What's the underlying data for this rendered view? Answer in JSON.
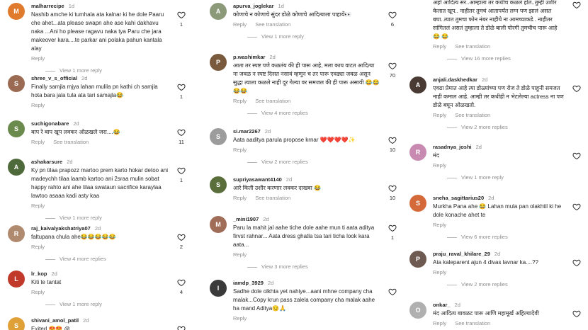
{
  "ui": {
    "reply": "Reply",
    "see_translation": "See translation"
  },
  "col1": [
    {
      "user": "malharrecipe",
      "age": "1d",
      "text": "Nashib amche ki tumhala ata kalnar ki he dole Paaru che ahet...ata please swapn ahe ase kahi dakhavu naka ...Ani ho please ragavu naka tya Paru che jara makeover kara....te parkar ani polaka pahun kantala alay",
      "likes": "1",
      "translate": false,
      "replies": "View 1 more reply",
      "avatar_color": "#e07b2e",
      "avatar_letter": "M"
    },
    {
      "user": "shree_v_s_official",
      "age": "2d",
      "text": "Finally samjla mjya lahan mulila pn kathi ch samjla hota bara jala tula ata tari samajla😂",
      "likes": "1",
      "translate": false,
      "replies": "",
      "avatar_color": "#9a6a53",
      "avatar_letter": "S"
    },
    {
      "user": "suchigonabare",
      "age": "2d",
      "text": "बाप रे बाप खूप लवकर ओळखले जरा....😂",
      "likes": "11",
      "translate": true,
      "replies": "",
      "avatar_color": "#6b8a4e",
      "avatar_letter": "S"
    },
    {
      "user": "ashakarsure",
      "age": "2d",
      "text": "Ky pn tilaa prapozz martoo prem karto hokar detoo ani madeychh tilaa laamb kartoo ani 2sraa mulin sobat happy rahto ani ahe tilaa swataun sacrifice karaylaa lawtoo asaaa kadi asty kaa",
      "likes": "1",
      "translate": false,
      "replies": "View 1 more reply",
      "avatar_color": "#4f6a3a",
      "avatar_letter": "A"
    },
    {
      "user": "raj_kaivalyakshatriya07",
      "age": "2d",
      "text": "faltupana chula ahe😂😂😂😂😂",
      "likes": "2",
      "translate": false,
      "replies": "View 4 more replies",
      "avatar_color": "#b08a6e",
      "avatar_letter": "R"
    },
    {
      "user": "lr_kop",
      "age": "2d",
      "text": "Kiti te tantat",
      "likes": "4",
      "translate": false,
      "replies": "View 1 more reply",
      "avatar_color": "#c0392b",
      "avatar_letter": "L"
    },
    {
      "user": "shivani_amol_patil",
      "age": "2d",
      "text": "Exited 😍😍 @ ...",
      "likes": "",
      "translate": false,
      "replies": "",
      "avatar_color": "#e0a038",
      "avatar_letter": "S"
    }
  ],
  "col2": [
    {
      "user": "apurva_joglekar",
      "age": "1d",
      "text": "कोणाचे न कोणाचे सुंदर डोळे कोणाचे आदित्याला पाहायें👀",
      "likes": "6",
      "translate": true,
      "replies": "View 1 more reply",
      "avatar_color": "#8c9a7a",
      "avatar_letter": "A"
    },
    {
      "user": "p.washimkar",
      "age": "2d",
      "text": "आता तर स्पष्ट पणे कळतंय की ही पारू आहे, मला काय वाटत आदित्या ना जवळ न स्पष्ट दिसत नसावं म्हणून च तर पारू एवढ्या जवळ असून सुद्धा त्याला कळले नाही दूर गेल्या वर समजल की ही पारू असावी 😂😂😂😂",
      "likes": "70",
      "translate": true,
      "replies": "View 4 more replies",
      "avatar_color": "#7a5a3c",
      "avatar_letter": "P"
    },
    {
      "user": "si.mar2267",
      "age": "2d",
      "text": "Aata aaditya parula propose krnar ❤️❤️❤️❤️✨",
      "likes": "10",
      "translate": false,
      "replies": "View 2 more replies",
      "avatar_color": "#9c9c9c",
      "avatar_letter": "S"
    },
    {
      "user": "supriyasawant4140",
      "age": "2d",
      "text": "आरे किती उशीर करणार लवकर दाखवा 😂",
      "likes": "10",
      "translate": true,
      "replies": "",
      "avatar_color": "#5a6e3c",
      "avatar_letter": "S"
    },
    {
      "user": "_mini1907",
      "age": "2d",
      "text": "Paru la mahit jal aahe tiche dole aahe mun ti aata aditya firvst rahnar... Aata dress ghatla tsa tari ticha look kara aata...",
      "likes": "1",
      "translate": false,
      "replies": "View 3 more replies",
      "avatar_color": "#a06e58",
      "avatar_letter": "M"
    },
    {
      "user": "iamdp_3929",
      "age": "2d",
      "text": "Sadhe dole olkhta yet nahiye...aani mhne company cha malak...Copy krun pass zalela company cha malak aahe ha mand Aditya😏🙏",
      "likes": "",
      "translate": false,
      "replies": "",
      "avatar_color": "#3a3a3a",
      "avatar_letter": "I"
    }
  ],
  "col3": [
    {
      "user": "",
      "age": "",
      "text": "अहो आदित्य सर..आम्हाला तर कधीच कळलं होतं..तुम्ही उशीर केलात खूप.. नाहीतर तुमचं आतापर्यंत लग्न पण झालं असत बघा..त्यात तुमचा फोन नंबर नाहीये ना आमच्याकडे.. नाहीतर सांगितलं असतं तुम्हाला ते डोळे बाली पोरगी तुमचीच पारू आहे 😂 😂",
      "likes": "",
      "translate": true,
      "replies": "View 16 more replies",
      "avatar_color": "",
      "avatar_letter": ""
    },
    {
      "user": "anjali.daskhedkar",
      "age": "2d",
      "text": "एवढा प्रेमात आहे त्या डोळ्यांच्या पण रोज ते डोळे पाहुनी समजत नाही कमाल आहे. आम्ही तर कधीही न भेटलेल्या actress ना पण डोळे बघून ओळखतो.",
      "likes": "",
      "translate": true,
      "replies": "View 2 more replies",
      "avatar_color": "#4a3a34",
      "avatar_letter": "A"
    },
    {
      "user": "rasadnya_joshi",
      "age": "2d",
      "text": "मंद",
      "likes": "",
      "translate": false,
      "replies": "View 1 more reply",
      "avatar_color": "#c88ab0",
      "avatar_letter": "R"
    },
    {
      "user": "sneha_sagittarius20",
      "age": "2d",
      "text": "Murkha Pana ahe 😂 Lahan mula pan olakhtil ki he dole konache ahet te",
      "likes": "",
      "translate": false,
      "replies": "View 6 more replies",
      "avatar_color": "#d46a3a",
      "avatar_letter": "S"
    },
    {
      "user": "praju_raval_khilare_29",
      "age": "2d",
      "text": "Ata kaleparent ajun 4 divas lavnar ka....??",
      "likes": "",
      "translate": false,
      "replies": "View 2 more replies",
      "avatar_color": "#6e5a50",
      "avatar_letter": "P"
    },
    {
      "user": "onkar_",
      "age": "2d",
      "text": "मंद आदित्य बावळट पारू आणि महामूर्ख अहिल्यादेवी",
      "likes": "",
      "translate": true,
      "replies": "",
      "avatar_color": "#b0b0b0",
      "avatar_letter": "O"
    }
  ]
}
